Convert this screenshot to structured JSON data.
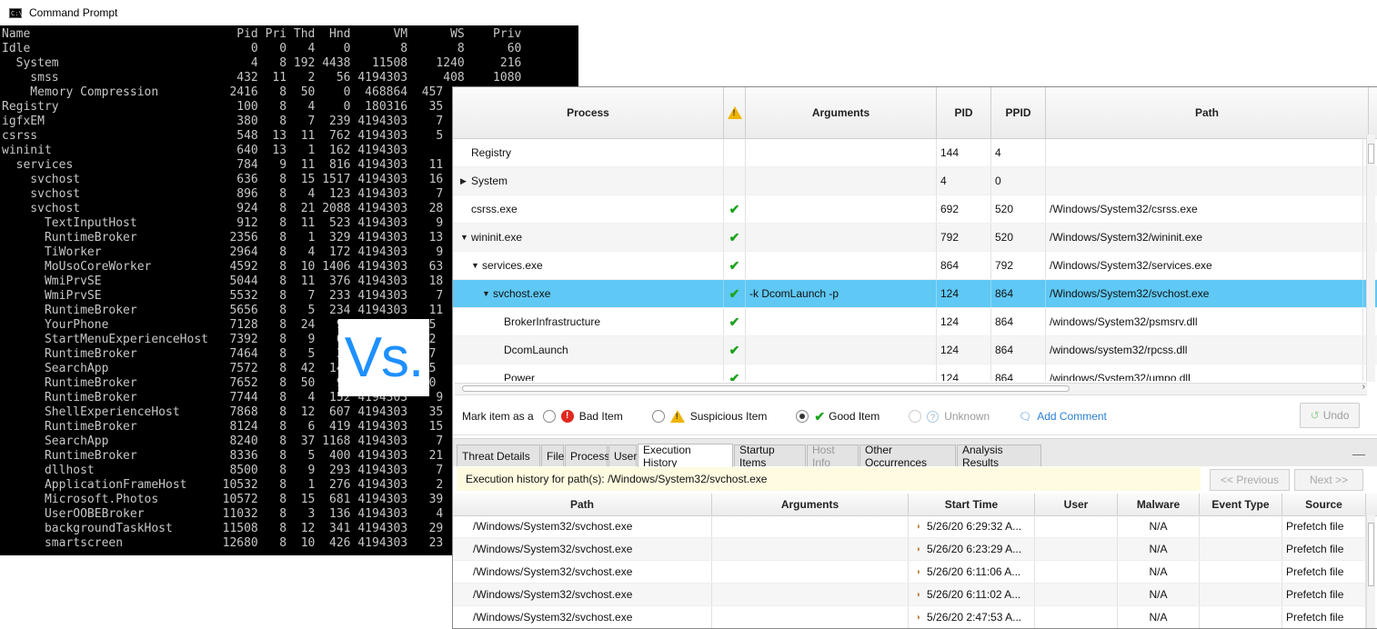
{
  "cmd": {
    "title": "Command Prompt",
    "icon": "terminal-icon",
    "lines": [
      "Name                             Pid Pri Thd  Hnd      VM      WS    Priv",
      "Idle                               0   0   4    0       8       8      60",
      "  System                           4   8 192 4438   11508    1240     216",
      "    smss                         432  11   2   56 4194303     408    1080",
      "    Memory Compression          2416   8  50    0  468864  457",
      "Registry                         100   8   4    0  180316   35",
      "igfxEM                           380   8   7  239 4194303    7",
      "csrss                            548  13  11  762 4194303    5",
      "wininit                          640  13   1  162 4194303",
      "  services                       784   9  11  816 4194303   11",
      "    svchost                      636   8  15 1517 4194303   16",
      "    svchost                      896   8   4  123 4194303    7",
      "    svchost                      924   8  21 2088 4194303   28",
      "      TextInputHost              912   8  11  523 4194303    9",
      "      RuntimeBroker             2356   8   1  329 4194303   13",
      "      TiWorker                  2964   8   4  172 4194303    9",
      "      MoUsoCoreWorker           4592   8  10 1406 4194303   63",
      "      WmiPrvSE                  5044   8  11  376 4194303   18",
      "      WmiPrvSE                  5532   8   7  233 4194303    7",
      "      RuntimeBroker             5656   8   5  234 4194303   11",
      "      YourPhone                 7128   8  24   9           35",
      "      StartMenuExperienceHost   7392   8   9   6           42",
      "      RuntimeBroker             7464   8   5   3            7",
      "      SearchApp                 7572   8  42  14          195",
      "      RuntimeBroker             7652   8  50   9           40",
      "      RuntimeBroker             7744   8   4  152 4194303    9",
      "      ShellExperienceHost       7868   8  12  607 4194303   35",
      "      RuntimeBroker             8124   8   6  419 4194303   15",
      "      SearchApp                 8240   8  37 1168 4194303    7",
      "      RuntimeBroker             8336   8   5  400 4194303   21",
      "      dllhost                   8500   8   9  293 4194303    7",
      "      ApplicationFrameHost     10532   8   1  276 4194303    2",
      "      Microsoft.Photos         10572   8  15  681 4194303   39",
      "      UserOOBEBroker           11032   8   3  136 4194303    4",
      "      backgroundTaskHost       11508   8  12  341 4194303   29",
      "      smartscreen              12680   8  10  426 4194303   23"
    ]
  },
  "vs_label": "Vs.",
  "app": {
    "process_table": {
      "headers": {
        "process": "Process",
        "warn_icon": "warning-icon",
        "arguments": "Arguments",
        "pid": "PID",
        "ppid": "PPID",
        "path": "Path"
      },
      "rows": [
        {
          "name": "Registry",
          "indent": 0,
          "toggle": "",
          "status": "",
          "args": "",
          "pid": "144",
          "ppid": "4",
          "path": ""
        },
        {
          "name": "System",
          "indent": 0,
          "toggle": "▶",
          "status": "",
          "args": "",
          "pid": "4",
          "ppid": "0",
          "path": ""
        },
        {
          "name": "csrss.exe",
          "indent": 0,
          "toggle": "",
          "status": "✔",
          "args": "",
          "pid": "692",
          "ppid": "520",
          "path": "/Windows/System32/csrss.exe"
        },
        {
          "name": "wininit.exe",
          "indent": 0,
          "toggle": "▼",
          "status": "✔",
          "args": "",
          "pid": "792",
          "ppid": "520",
          "path": "/Windows/System32/wininit.exe"
        },
        {
          "name": "services.exe",
          "indent": 1,
          "toggle": "▼",
          "status": "✔",
          "args": "",
          "pid": "864",
          "ppid": "792",
          "path": "/Windows/System32/services.exe"
        },
        {
          "name": "svchost.exe",
          "indent": 2,
          "toggle": "▼",
          "status": "✔",
          "args": "-k DcomLaunch -p",
          "pid": "124",
          "ppid": "864",
          "path": "/Windows/System32/svchost.exe",
          "selected": true
        },
        {
          "name": "BrokerInfrastructure",
          "indent": 3,
          "toggle": "",
          "status": "✔",
          "args": "",
          "pid": "124",
          "ppid": "864",
          "path": "/windows/System32/psmsrv.dll"
        },
        {
          "name": "DcomLaunch",
          "indent": 3,
          "toggle": "",
          "status": "✔",
          "args": "",
          "pid": "124",
          "ppid": "864",
          "path": "/windows/system32/rpcss.dll"
        },
        {
          "name": "Power",
          "indent": 3,
          "toggle": "",
          "status": "✔",
          "args": "",
          "pid": "124",
          "ppid": "864",
          "path": "/windows/System32/umpo.dll"
        }
      ]
    },
    "mark_bar": {
      "label": "Mark item as a",
      "bad": "Bad Item",
      "suspicious": "Suspicious Item",
      "good": "Good Item",
      "unknown": "Unknown",
      "add_comment": "Add Comment",
      "undo": "Undo",
      "selected": "good"
    },
    "tabs": [
      "Threat Details",
      "File",
      "Process",
      "User",
      "Execution History",
      "Startup Items",
      "Host Info",
      "Other Occurrences",
      "Analysis Results"
    ],
    "active_tab": "Execution History",
    "disabled_tabs": [
      "Host Info"
    ],
    "exec": {
      "info": "Execution history for path(s): /Windows/System32/svchost.exe",
      "prev": "<< Previous",
      "next": "Next >>",
      "headers": {
        "path": "Path",
        "arguments": "Arguments",
        "start_time": "Start Time",
        "user": "User",
        "malware": "Malware",
        "event_type": "Event Type",
        "source": "Source"
      },
      "rows": [
        {
          "path": "/Windows/System32/svchost.exe",
          "args": "",
          "start": "5/26/20 6:29:32 A...",
          "user": "",
          "malware": "N/A",
          "event": "",
          "source": "Prefetch file"
        },
        {
          "path": "/Windows/System32/svchost.exe",
          "args": "",
          "start": "5/26/20 6:23:29 A...",
          "user": "",
          "malware": "N/A",
          "event": "",
          "source": "Prefetch file"
        },
        {
          "path": "/Windows/System32/svchost.exe",
          "args": "",
          "start": "5/26/20 6:11:06 A...",
          "user": "",
          "malware": "N/A",
          "event": "",
          "source": "Prefetch file"
        },
        {
          "path": "/Windows/System32/svchost.exe",
          "args": "",
          "start": "5/26/20 6:11:02 A...",
          "user": "",
          "malware": "N/A",
          "event": "",
          "source": "Prefetch file"
        },
        {
          "path": "/Windows/System32/svchost.exe",
          "args": "",
          "start": "5/26/20 2:47:53 A...",
          "user": "",
          "malware": "N/A",
          "event": "",
          "source": "Prefetch file"
        }
      ]
    }
  }
}
